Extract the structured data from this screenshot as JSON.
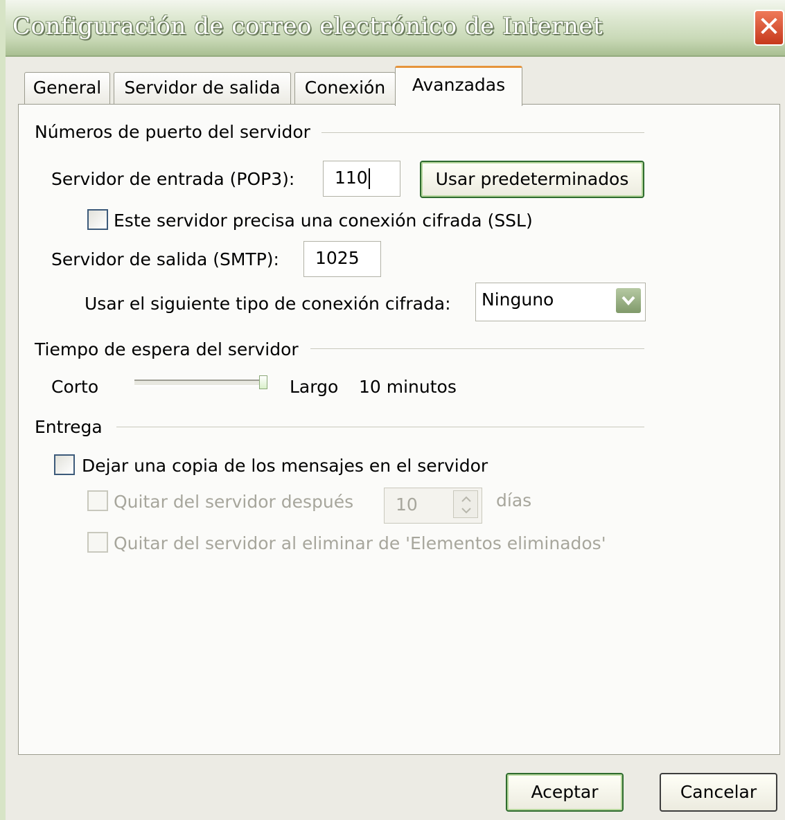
{
  "window": {
    "title": "Configuración de correo electrónico de Internet"
  },
  "tabs": [
    {
      "label": "General"
    },
    {
      "label": "Servidor de salida"
    },
    {
      "label": "Conexión"
    },
    {
      "label": "Avanzadas"
    }
  ],
  "ports": {
    "group_label": "Números de puerto del servidor",
    "incoming_label": "Servidor de entrada (POP3):",
    "incoming_value": "110",
    "defaults_button": "Usar predeterminados",
    "ssl_checkbox_label": "Este servidor precisa una conexión cifrada (SSL)",
    "ssl_checked": false,
    "outgoing_label": "Servidor de salida (SMTP):",
    "outgoing_value": "1025",
    "encryption_label": "Usar el siguiente tipo de conexión cifrada:",
    "encryption_selected": "Ninguno"
  },
  "timeout": {
    "group_label": "Tiempo de espera del servidor",
    "short_label": "Corto",
    "long_label": "Largo",
    "value_text": "10 minutos",
    "slider_level": 1.0
  },
  "delivery": {
    "group_label": "Entrega",
    "leave_copy_label": "Dejar una copia de los mensajes en el servidor",
    "leave_copy_checked": false,
    "remove_after_label": "Quitar del servidor después",
    "remove_after_days": "10",
    "days_unit": "días",
    "remove_on_delete_label": "Quitar del servidor al eliminar de 'Elementos eliminados'"
  },
  "footer": {
    "ok_label": "Aceptar",
    "cancel_label": "Cancelar"
  },
  "colors": {
    "title_green": "#a9bf92",
    "close_red": "#c6391c",
    "active_tab_accent": "#e6943a"
  }
}
